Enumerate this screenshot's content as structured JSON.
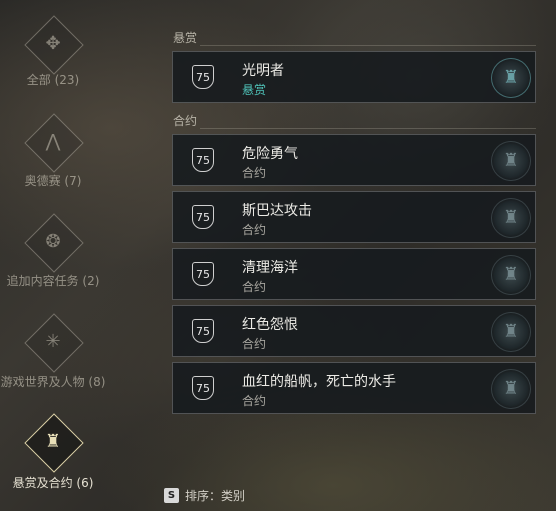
{
  "sidebar": {
    "categories": [
      {
        "label": "全部 (23)",
        "icon": "knot-icon",
        "glyph": "✥",
        "active": false
      },
      {
        "label": "奥德赛 (7)",
        "icon": "spartan-tree-icon",
        "glyph": "⋀",
        "active": false
      },
      {
        "label": "追加内容任务 (2)",
        "icon": "dlc-crest-icon",
        "glyph": "❂",
        "active": false
      },
      {
        "label": "游戏世界及人物 (8)",
        "icon": "starburst-icon",
        "glyph": "✳",
        "active": false
      },
      {
        "label": "悬赏及合约 (6)",
        "icon": "bounty-helmet-icon",
        "glyph": "♜",
        "active": true
      }
    ]
  },
  "sections": {
    "bounty": "悬赏",
    "contracts": "合约"
  },
  "quests": [
    {
      "level": "75",
      "title": "光明者",
      "type": "悬赏"
    },
    {
      "level": "75",
      "title": "危险勇气",
      "type": "合约"
    },
    {
      "level": "75",
      "title": "斯巴达攻击",
      "type": "合约"
    },
    {
      "level": "75",
      "title": "清理海洋",
      "type": "合约"
    },
    {
      "level": "75",
      "title": "红色怨恨",
      "type": "合约"
    },
    {
      "level": "75",
      "title": "血红的船帆，死亡的水手",
      "type": "合约"
    }
  ],
  "footer": {
    "key": "S",
    "sort_label": "排序：类别"
  },
  "colors": {
    "bounty_type": "#4fc2b8",
    "active_category": "#d9cfa5"
  }
}
